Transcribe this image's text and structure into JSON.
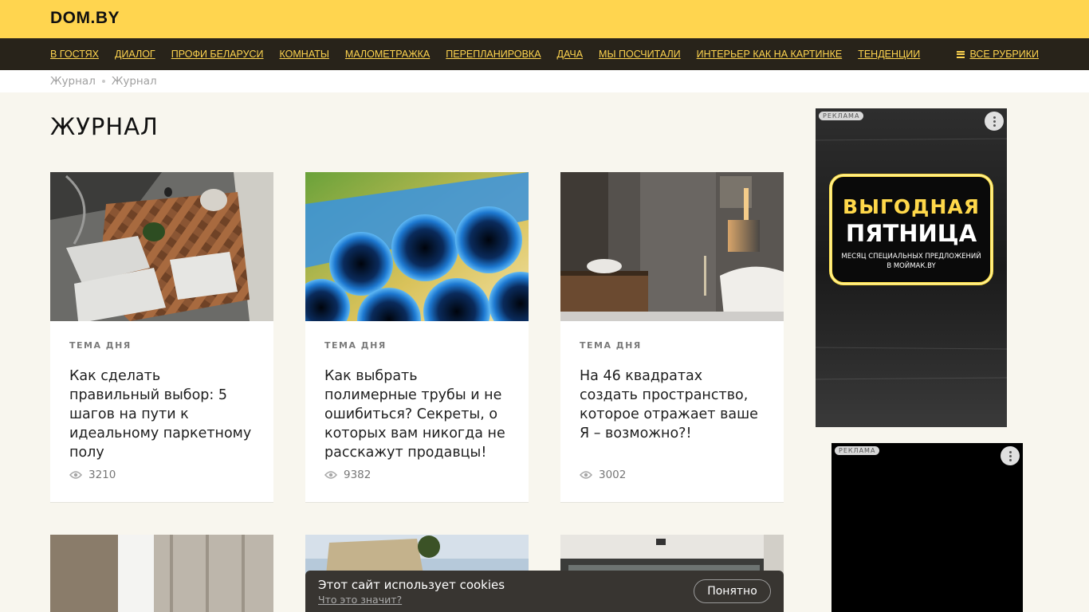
{
  "header": {
    "logo": "DOM.BY"
  },
  "nav": {
    "items": [
      "В ГОСТЯХ",
      "ДИАЛОГ",
      "ПРОФИ БЕЛАРУСИ",
      "КОМНАТЫ",
      "МАЛОМЕТРАЖКА",
      "ПЕРЕПЛАНИРОВКА",
      "ДАЧА",
      "МЫ ПОСЧИТАЛИ",
      "ИНТЕРЬЕР КАК НА КАРТИНКЕ",
      "ТЕНДЕНЦИИ"
    ],
    "all_rubrics": "ВСЕ РУБРИКИ"
  },
  "breadcrumbs": [
    "Журнал",
    "Журнал"
  ],
  "page_title": "ЖУРНАЛ",
  "cards": [
    {
      "tag": "ТЕМА ДНЯ",
      "title": "Как сделать правильный выбор: 5 шагов на пути к идеальному паркетному полу",
      "views": "3210"
    },
    {
      "tag": "ТЕМА ДНЯ",
      "title": "Как выбрать полимерные трубы и не ошибиться? Секреты, о которых вам никогда не расскажут продавцы!",
      "views": "9382"
    },
    {
      "tag": "ТЕМА ДНЯ",
      "title": "На 46 квадратах создать пространство, которое отражает ваше Я – возможно?!",
      "views": "3002"
    }
  ],
  "ads": {
    "label": "РЕКЛАМА",
    "banner": {
      "line1": "ВЫГОДНАЯ",
      "line2": "ПЯТНИЦА",
      "line3": "МЕСЯЦ СПЕЦИАЛЬНЫХ ПРЕДЛОЖЕНИЙ",
      "line4": "В МОЙМАК.BY"
    }
  },
  "cookie": {
    "text": "Этот сайт использует cookies",
    "link": "Что это значит?",
    "button": "Понятно"
  },
  "colors": {
    "brand_yellow": "#ffd54f",
    "nav_dark": "#28231a",
    "background": "#f8f6ee",
    "neon": "#ffe14a"
  }
}
